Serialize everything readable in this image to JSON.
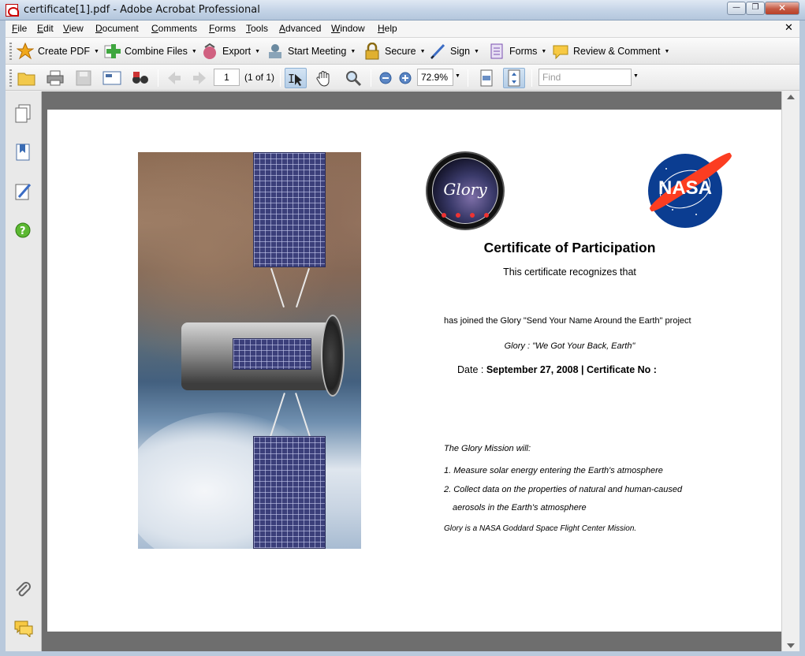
{
  "window": {
    "title": "certificate[1].pdf - Adobe Acrobat Professional",
    "min_label": "—",
    "max_label": "❐",
    "close_label": "✕"
  },
  "menu": {
    "items": [
      "File",
      "Edit",
      "View",
      "Document",
      "Comments",
      "Forms",
      "Tools",
      "Advanced",
      "Window",
      "Help"
    ],
    "close_doc": "✕"
  },
  "tasks": {
    "create_pdf": "Create PDF",
    "combine_files": "Combine Files",
    "export": "Export",
    "start_meeting": "Start Meeting",
    "secure": "Secure",
    "sign": "Sign",
    "forms": "Forms",
    "review_comment": "Review & Comment"
  },
  "nav": {
    "page_number": "1",
    "page_count": "(1 of 1)",
    "zoom": "72.9%",
    "find_placeholder": "Find"
  },
  "certificate": {
    "title": "Certificate of Participation",
    "recognizes": "This certificate recognizes that",
    "joined": "has joined the Glory \"Send Your Name Around the Earth\" project",
    "slogan": "Glory : \"We Got Your Back, Earth\"",
    "date_label": "Date : ",
    "date_value": "September 27, 2008 | Certificate No :",
    "mission_heading": "The Glory Mission will:",
    "item1": "1. Measure solar energy entering the Earth's atmosphere",
    "item2a": "2. Collect data on the properties of natural and human-caused",
    "item2b": "aerosols in the Earth's atmosphere",
    "footer": "Glory is a NASA Goddard Space Flight Center Mission."
  },
  "logos": {
    "glory_word": "Glory",
    "nasa_word": "NASA"
  },
  "colors": {
    "nasa_blue": "#0b3d91",
    "nasa_red": "#fc3d21",
    "doc_background": "#6e6e6e"
  }
}
